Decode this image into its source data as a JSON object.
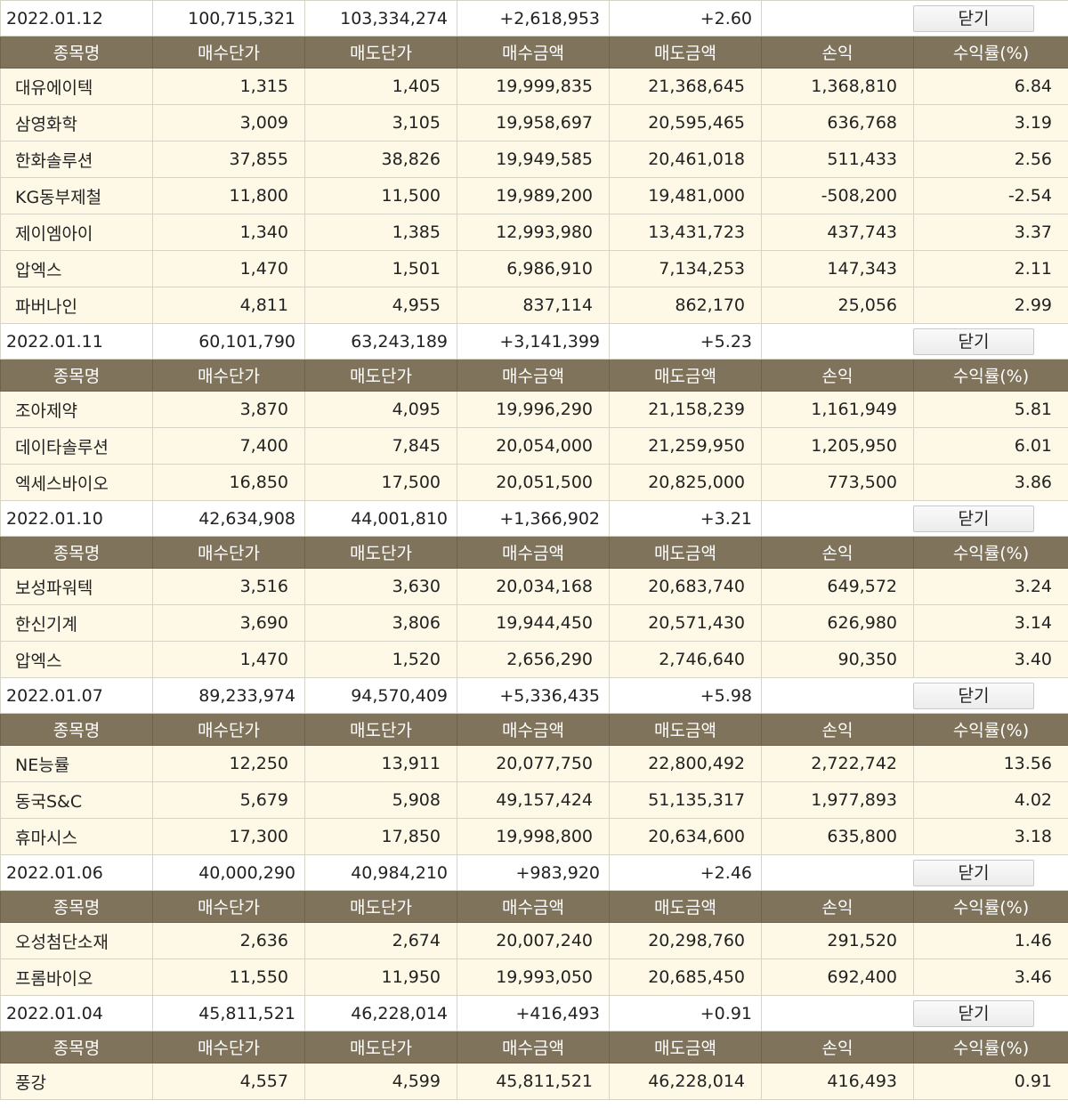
{
  "headers": [
    "종목명",
    "매수단가",
    "매도단가",
    "매수금액",
    "매도금액",
    "손익",
    "수익률(%)"
  ],
  "close_label": "닫기",
  "days": [
    {
      "date": "2022.01.12",
      "buy_total": "100,715,321",
      "sell_total": "103,334,274",
      "profit": "+2,618,953",
      "rate": "+2.60",
      "rows": [
        {
          "name": "대유에이텍",
          "buy_price": "1,315",
          "sell_price": "1,405",
          "buy_amount": "19,999,835",
          "sell_amount": "21,368,645",
          "pnl": "1,368,810",
          "rate": "6.84",
          "sign": "pos"
        },
        {
          "name": "삼영화학",
          "buy_price": "3,009",
          "sell_price": "3,105",
          "buy_amount": "19,958,697",
          "sell_amount": "20,595,465",
          "pnl": "636,768",
          "rate": "3.19",
          "sign": "pos"
        },
        {
          "name": "한화솔루션",
          "buy_price": "37,855",
          "sell_price": "38,826",
          "buy_amount": "19,949,585",
          "sell_amount": "20,461,018",
          "pnl": "511,433",
          "rate": "2.56",
          "sign": "pos"
        },
        {
          "name": "KG동부제철",
          "buy_price": "11,800",
          "sell_price": "11,500",
          "buy_amount": "19,989,200",
          "sell_amount": "19,481,000",
          "pnl": "-508,200",
          "rate": "-2.54",
          "sign": "neg"
        },
        {
          "name": "제이엠아이",
          "buy_price": "1,340",
          "sell_price": "1,385",
          "buy_amount": "12,993,980",
          "sell_amount": "13,431,723",
          "pnl": "437,743",
          "rate": "3.37",
          "sign": "pos"
        },
        {
          "name": "압엑스",
          "buy_price": "1,470",
          "sell_price": "1,501",
          "buy_amount": "6,986,910",
          "sell_amount": "7,134,253",
          "pnl": "147,343",
          "rate": "2.11",
          "sign": "pos"
        },
        {
          "name": "파버나인",
          "buy_price": "4,811",
          "sell_price": "4,955",
          "buy_amount": "837,114",
          "sell_amount": "862,170",
          "pnl": "25,056",
          "rate": "2.99",
          "sign": "pos"
        }
      ]
    },
    {
      "date": "2022.01.11",
      "buy_total": "60,101,790",
      "sell_total": "63,243,189",
      "profit": "+3,141,399",
      "rate": "+5.23",
      "rows": [
        {
          "name": "조아제약",
          "buy_price": "3,870",
          "sell_price": "4,095",
          "buy_amount": "19,996,290",
          "sell_amount": "21,158,239",
          "pnl": "1,161,949",
          "rate": "5.81",
          "sign": "pos"
        },
        {
          "name": "데이타솔루션",
          "buy_price": "7,400",
          "sell_price": "7,845",
          "buy_amount": "20,054,000",
          "sell_amount": "21,259,950",
          "pnl": "1,205,950",
          "rate": "6.01",
          "sign": "pos"
        },
        {
          "name": "엑세스바이오",
          "buy_price": "16,850",
          "sell_price": "17,500",
          "buy_amount": "20,051,500",
          "sell_amount": "20,825,000",
          "pnl": "773,500",
          "rate": "3.86",
          "sign": "pos"
        }
      ]
    },
    {
      "date": "2022.01.10",
      "buy_total": "42,634,908",
      "sell_total": "44,001,810",
      "profit": "+1,366,902",
      "rate": "+3.21",
      "rows": [
        {
          "name": "보성파워텍",
          "buy_price": "3,516",
          "sell_price": "3,630",
          "buy_amount": "20,034,168",
          "sell_amount": "20,683,740",
          "pnl": "649,572",
          "rate": "3.24",
          "sign": "pos"
        },
        {
          "name": "한신기계",
          "buy_price": "3,690",
          "sell_price": "3,806",
          "buy_amount": "19,944,450",
          "sell_amount": "20,571,430",
          "pnl": "626,980",
          "rate": "3.14",
          "sign": "pos"
        },
        {
          "name": "압엑스",
          "buy_price": "1,470",
          "sell_price": "1,520",
          "buy_amount": "2,656,290",
          "sell_amount": "2,746,640",
          "pnl": "90,350",
          "rate": "3.40",
          "sign": "pos"
        }
      ]
    },
    {
      "date": "2022.01.07",
      "buy_total": "89,233,974",
      "sell_total": "94,570,409",
      "profit": "+5,336,435",
      "rate": "+5.98",
      "rows": [
        {
          "name": "NE능률",
          "buy_price": "12,250",
          "sell_price": "13,911",
          "buy_amount": "20,077,750",
          "sell_amount": "22,800,492",
          "pnl": "2,722,742",
          "rate": "13.56",
          "sign": "pos"
        },
        {
          "name": "동국S&C",
          "buy_price": "5,679",
          "sell_price": "5,908",
          "buy_amount": "49,157,424",
          "sell_amount": "51,135,317",
          "pnl": "1,977,893",
          "rate": "4.02",
          "sign": "pos"
        },
        {
          "name": "휴마시스",
          "buy_price": "17,300",
          "sell_price": "17,850",
          "buy_amount": "19,998,800",
          "sell_amount": "20,634,600",
          "pnl": "635,800",
          "rate": "3.18",
          "sign": "pos"
        }
      ]
    },
    {
      "date": "2022.01.06",
      "buy_total": "40,000,290",
      "sell_total": "40,984,210",
      "profit": "+983,920",
      "rate": "+2.46",
      "rows": [
        {
          "name": "오성첨단소재",
          "buy_price": "2,636",
          "sell_price": "2,674",
          "buy_amount": "20,007,240",
          "sell_amount": "20,298,760",
          "pnl": "291,520",
          "rate": "1.46",
          "sign": "pos"
        },
        {
          "name": "프롬바이오",
          "buy_price": "11,550",
          "sell_price": "11,950",
          "buy_amount": "19,993,050",
          "sell_amount": "20,685,450",
          "pnl": "692,400",
          "rate": "3.46",
          "sign": "pos"
        }
      ]
    },
    {
      "date": "2022.01.04",
      "buy_total": "45,811,521",
      "sell_total": "46,228,014",
      "profit": "+416,493",
      "rate": "+0.91",
      "rows": [
        {
          "name": "풍강",
          "buy_price": "4,557",
          "sell_price": "4,599",
          "buy_amount": "45,811,521",
          "sell_amount": "46,228,014",
          "pnl": "416,493",
          "rate": "0.91",
          "sign": "pos"
        }
      ]
    }
  ]
}
